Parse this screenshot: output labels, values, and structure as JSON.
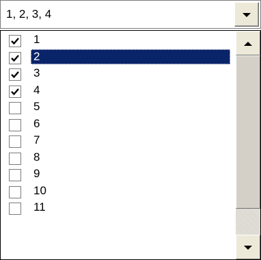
{
  "combo": {
    "selected_text": "1, 2, 3, 4",
    "dropdown_icon": "chevron-down-icon"
  },
  "list": {
    "items": [
      {
        "label": "1",
        "checked": true
      },
      {
        "label": "2",
        "checked": true,
        "selected": true
      },
      {
        "label": "3",
        "checked": true
      },
      {
        "label": "4",
        "checked": true
      },
      {
        "label": "5",
        "checked": false
      },
      {
        "label": "6",
        "checked": false
      },
      {
        "label": "7",
        "checked": false
      },
      {
        "label": "8",
        "checked": false
      },
      {
        "label": "9",
        "checked": false
      },
      {
        "label": "10",
        "checked": false
      },
      {
        "label": "11",
        "checked": false
      }
    ]
  },
  "colors": {
    "selection_bg": "#0a246a",
    "selection_fg": "#ffffff",
    "face": "#d4d0c8"
  }
}
